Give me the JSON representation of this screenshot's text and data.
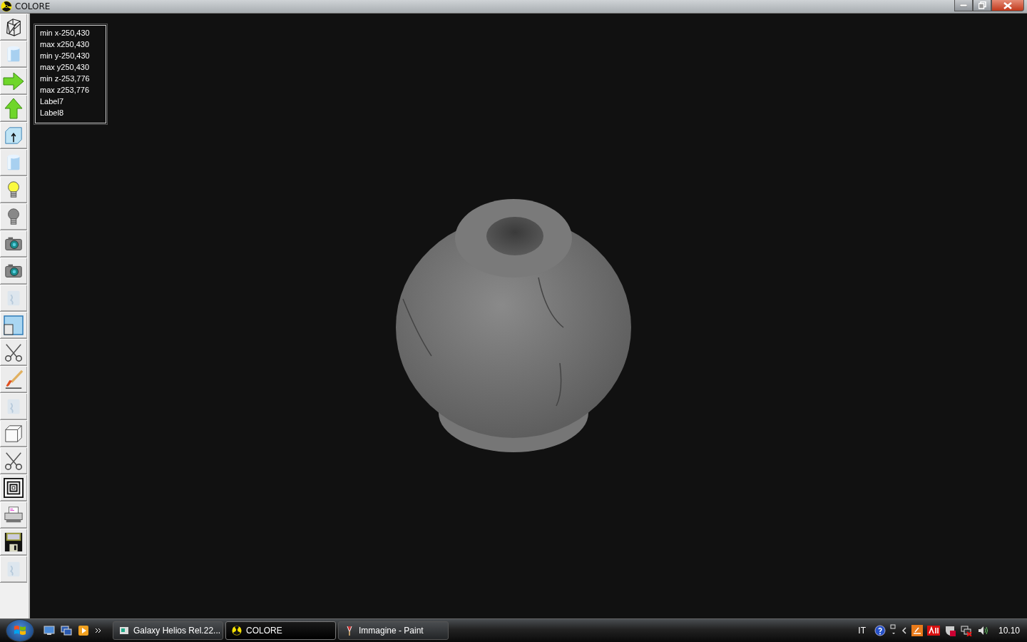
{
  "window": {
    "title": "COLORE"
  },
  "toolbar": [
    {
      "kind": "wireframe"
    },
    {
      "kind": "cylinder"
    },
    {
      "kind": "arrow-right"
    },
    {
      "kind": "arrow-up"
    },
    {
      "kind": "box-arrow"
    },
    {
      "kind": "cylinder"
    },
    {
      "kind": "bulb-on"
    },
    {
      "kind": "bulb-off"
    },
    {
      "kind": "camera"
    },
    {
      "kind": "camera"
    },
    {
      "kind": "faded"
    },
    {
      "kind": "window"
    },
    {
      "kind": "scissors"
    },
    {
      "kind": "brush"
    },
    {
      "kind": "faded"
    },
    {
      "kind": "cube"
    },
    {
      "kind": "scissors"
    },
    {
      "kind": "squares"
    },
    {
      "kind": "printer"
    },
    {
      "kind": "floppy"
    },
    {
      "kind": "faded"
    }
  ],
  "info_labels": [
    "min x-250,430",
    "max x250,430",
    "min y-250,430",
    "max y250,430",
    "min z-253,776",
    "max z253,776",
    "Label7",
    "Label8"
  ],
  "taskbar": {
    "buttons": [
      {
        "label": "Galaxy Helios  Rel.22...",
        "kind": "helios",
        "selected": false
      },
      {
        "label": "COLORE",
        "kind": "colore",
        "selected": true
      },
      {
        "label": "Immagine - Paint",
        "kind": "paint",
        "selected": false
      }
    ],
    "language": "IT",
    "clock": "10.10"
  }
}
